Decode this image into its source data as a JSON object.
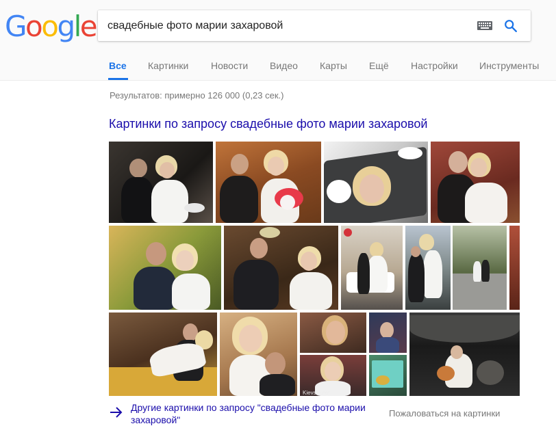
{
  "logo": {
    "text": "Google",
    "letters": [
      "G",
      "o",
      "o",
      "g",
      "l",
      "e"
    ],
    "colors": [
      "#4285F4",
      "#EA4335",
      "#FBBC05",
      "#4285F4",
      "#34A853",
      "#EA4335"
    ]
  },
  "search": {
    "query": "свадебные фото марии захаровой",
    "keyboard_icon": "keyboard-icon",
    "submit_icon": "search-icon",
    "accent": "#1a73e8"
  },
  "tabs": [
    {
      "label": "Все",
      "active": true
    },
    {
      "label": "Картинки",
      "active": false
    },
    {
      "label": "Новости",
      "active": false
    },
    {
      "label": "Видео",
      "active": false
    },
    {
      "label": "Карты",
      "active": false
    },
    {
      "label": "Ещё",
      "active": false
    },
    {
      "label": "Настройки",
      "active": false
    },
    {
      "label": "Инструменты",
      "active": false
    }
  ],
  "stats": "Результатов: примерно 126 000 (0,23 сек.)",
  "images_block": {
    "heading": "Картинки по запросу свадебные фото марии захаровой",
    "thumbnail_watermark": "Kievsm.net",
    "more_link": "Другие картинки по запросу \"свадебные фото марии захаровой\"",
    "report_link": "Пожаловаться на картинки"
  }
}
